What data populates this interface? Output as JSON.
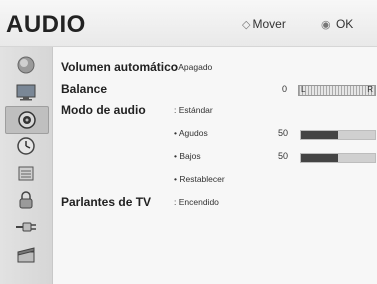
{
  "header": {
    "title": "AUDIO",
    "move_hint": "Mover",
    "move_icon": "dpad-icon",
    "ok_hint": "OK",
    "ok_icon": "ok-button-icon"
  },
  "sidebar": {
    "items": [
      {
        "icon": "satellite-dish-icon",
        "active": false
      },
      {
        "icon": "picture-display-icon",
        "active": false
      },
      {
        "icon": "audio-speaker-icon",
        "active": true
      },
      {
        "icon": "clock-icon",
        "active": false
      },
      {
        "icon": "lock-options-icon",
        "active": false
      },
      {
        "icon": "padlock-icon",
        "active": false
      },
      {
        "icon": "input-plug-icon",
        "active": false
      },
      {
        "icon": "movie-clapper-icon",
        "active": false
      }
    ]
  },
  "settings": {
    "auto_volume": {
      "label": "Volumen automático",
      "value": ": Apagado"
    },
    "balance": {
      "label": "Balance",
      "value": "0",
      "left": "L",
      "right": "R",
      "level": 0.5
    },
    "sound_mode": {
      "label": "Modo de audio",
      "value": ": Estándar",
      "treble": {
        "label": "• Agudos",
        "value": "50",
        "level": 0.5
      },
      "bass": {
        "label": "• Bajos",
        "value": "50",
        "level": 0.5
      },
      "reset": {
        "label": "• Restablecer"
      }
    },
    "tv_speaker": {
      "label": "Parlantes de TV",
      "value": ": Encendido"
    }
  }
}
